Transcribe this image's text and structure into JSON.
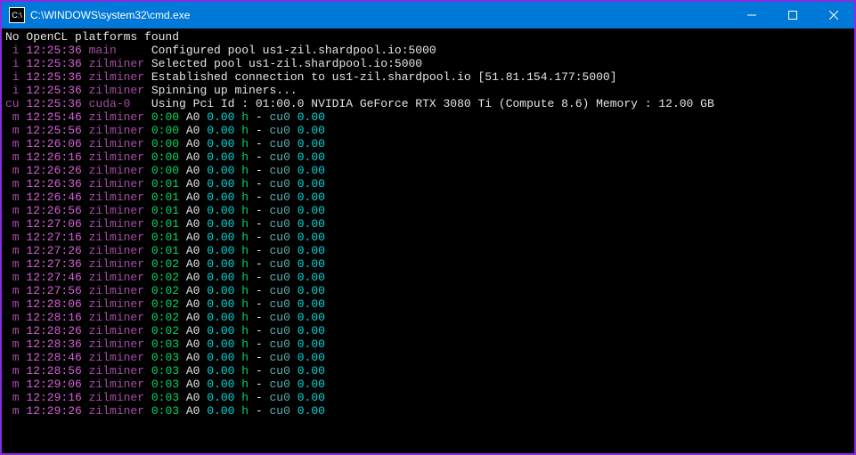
{
  "titlebar": {
    "title": "C:\\WINDOWS\\system32\\cmd.exe",
    "icon_glyph": "C:\\"
  },
  "header": {
    "no_platforms": "No OpenCL platforms found",
    "lines": [
      {
        "tag": "i",
        "time": "12:25:36",
        "logger": "main",
        "msg": "Configured pool us1-zil.shardpool.io:5000"
      },
      {
        "tag": "i",
        "time": "12:25:36",
        "logger": "zilminer",
        "msg": "Selected pool us1-zil.shardpool.io:5000"
      },
      {
        "tag": "i",
        "time": "12:25:36",
        "logger": "zilminer",
        "msg": "Established connection to us1-zil.shardpool.io [51.81.154.177:5000]"
      },
      {
        "tag": "i",
        "time": "12:25:36",
        "logger": "zilminer",
        "msg": "Spinning up miners..."
      }
    ],
    "cuda": {
      "tag": "cu",
      "time": "12:25:36",
      "logger": "cuda-0",
      "msg": "Using Pci Id : 01:00.0 NVIDIA GeForce RTX 3080 Ti (Compute 8.6) Memory : 12.00 GB"
    }
  },
  "stats": {
    "A": "A0",
    "hash": "0.00",
    "unit": "h",
    "sep": "-",
    "cpu": "cu0",
    "cpu_val": "0.00",
    "rows": [
      {
        "time": "12:25:46",
        "elapsed": "0:00"
      },
      {
        "time": "12:25:56",
        "elapsed": "0:00"
      },
      {
        "time": "12:26:06",
        "elapsed": "0:00"
      },
      {
        "time": "12:26:16",
        "elapsed": "0:00"
      },
      {
        "time": "12:26:26",
        "elapsed": "0:00"
      },
      {
        "time": "12:26:36",
        "elapsed": "0:01"
      },
      {
        "time": "12:26:46",
        "elapsed": "0:01"
      },
      {
        "time": "12:26:56",
        "elapsed": "0:01"
      },
      {
        "time": "12:27:06",
        "elapsed": "0:01"
      },
      {
        "time": "12:27:16",
        "elapsed": "0:01"
      },
      {
        "time": "12:27:26",
        "elapsed": "0:01"
      },
      {
        "time": "12:27:36",
        "elapsed": "0:02"
      },
      {
        "time": "12:27:46",
        "elapsed": "0:02"
      },
      {
        "time": "12:27:56",
        "elapsed": "0:02"
      },
      {
        "time": "12:28:06",
        "elapsed": "0:02"
      },
      {
        "time": "12:28:16",
        "elapsed": "0:02"
      },
      {
        "time": "12:28:26",
        "elapsed": "0:02"
      },
      {
        "time": "12:28:36",
        "elapsed": "0:03"
      },
      {
        "time": "12:28:46",
        "elapsed": "0:03"
      },
      {
        "time": "12:28:56",
        "elapsed": "0:03"
      },
      {
        "time": "12:29:06",
        "elapsed": "0:03"
      },
      {
        "time": "12:29:16",
        "elapsed": "0:03"
      },
      {
        "time": "12:29:26",
        "elapsed": "0:03"
      }
    ],
    "logger": "zilminer",
    "tag": "m"
  }
}
